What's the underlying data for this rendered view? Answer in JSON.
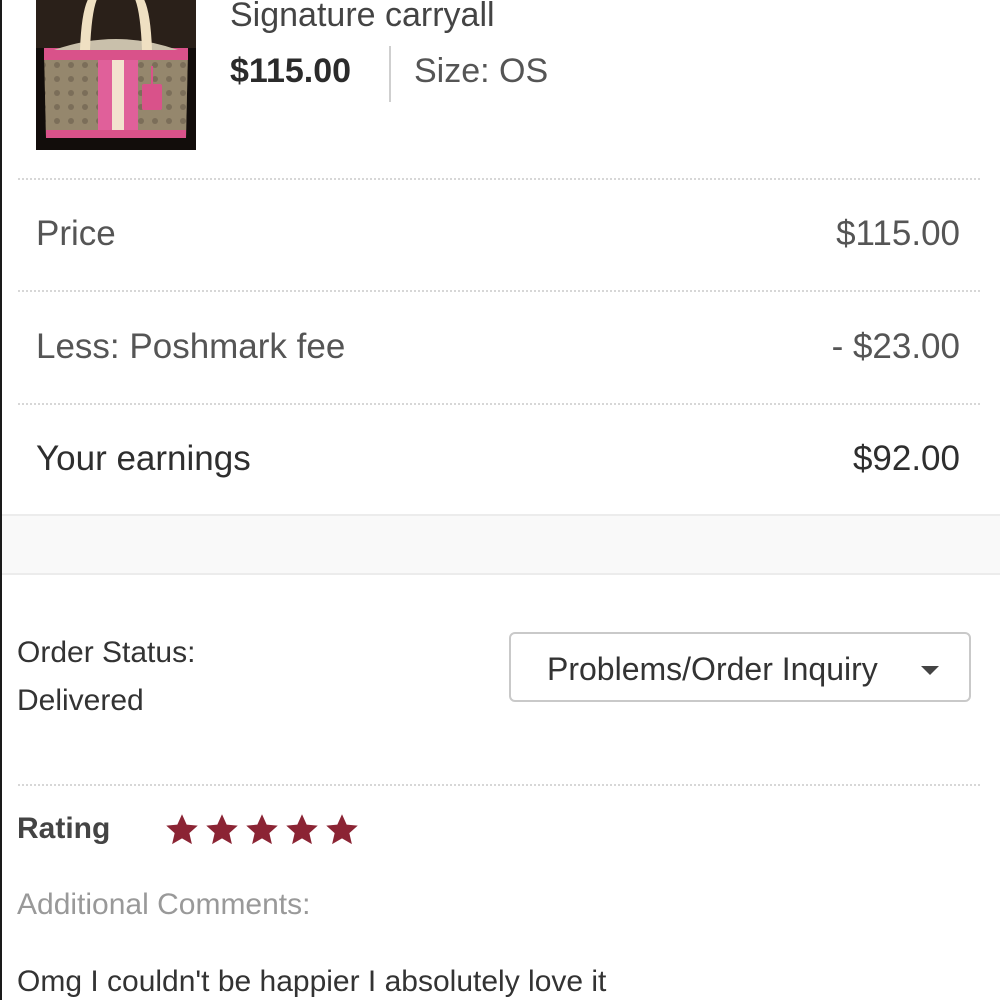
{
  "product": {
    "title": "Signature carryall",
    "price": "$115.00",
    "size": "Size: OS",
    "thumbnail_icon": "handbag-photo"
  },
  "earnings": {
    "rows": [
      {
        "label": "Price",
        "value": "$115.00"
      },
      {
        "label": "Less: Poshmark fee",
        "value": "- $23.00"
      },
      {
        "label": "Your earnings",
        "value": "$92.00"
      }
    ]
  },
  "order": {
    "status_label": "Order Status:",
    "status_value": "Delivered",
    "inquiry_button_label": "Problems/Order Inquiry",
    "inquiry_icon": "caret-down-icon"
  },
  "rating": {
    "label": "Rating",
    "stars": 5,
    "max_stars": 5,
    "star_color": "#8b2434",
    "comments_label": "Additional Comments:",
    "comment": "Omg I couldn't be happier I absolutely love it"
  }
}
